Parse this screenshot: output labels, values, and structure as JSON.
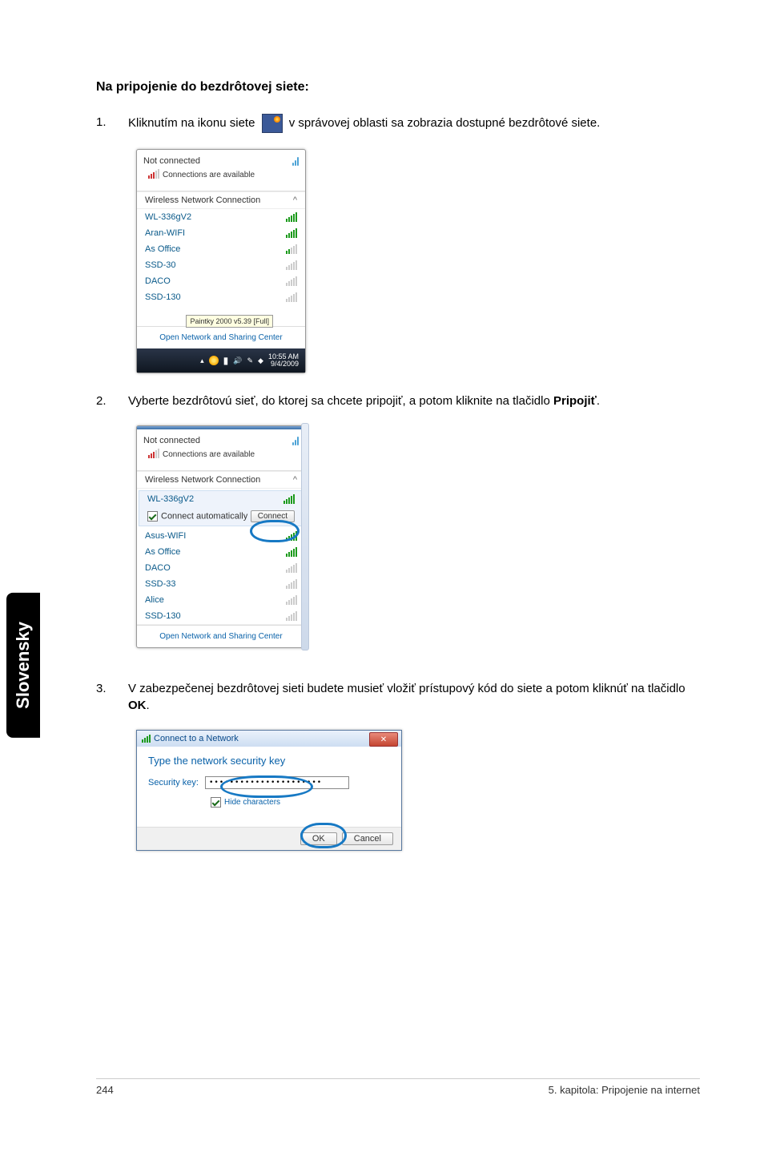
{
  "heading": "Na pripojenie do bezdrôtovej siete:",
  "step1": {
    "num": "1.",
    "text_a": "Kliknutím na ikonu siete ",
    "text_b": " v správovej oblasti sa zobrazia dostupné bezdrôtové siete."
  },
  "flyout1": {
    "not_connected": "Not connected",
    "conn_avail": "Connections are available",
    "section": "Wireless Network Connection",
    "nets": [
      "WL-336gV2",
      "Aran-WIFI",
      "As Office",
      "SSD-30",
      "DACO",
      "SSD-130"
    ],
    "open_center": "Open Network and Sharing Center",
    "tooltip": "Paintky 2000 v5.39 [Full]",
    "time1": "10:55 AM",
    "time2": "9/4/2009"
  },
  "step2": {
    "num": "2.",
    "text": "Vyberte bezdrôtovú sieť, do ktorej sa chcete pripojiť, a potom kliknite na tlačidlo",
    "bold": "Pripojiť"
  },
  "flyout2": {
    "not_connected": "Not connected",
    "conn_avail": "Connections are available",
    "section": "Wireless Network Connection",
    "selected": "WL-336gV2",
    "auto": "Connect automatically",
    "connect": "Connect",
    "nets": [
      "Asus-WIFI",
      "As Office",
      "DACO",
      "SSD-33",
      "Alice",
      "SSD-130"
    ],
    "open_center": "Open Network and Sharing Center"
  },
  "step3": {
    "num": "3.",
    "text": "V zabezpečenej bezdrôtovej sieti budete musieť vložiť prístupový kód do siete a potom kliknúť na tlačidlo ",
    "bold": "OK"
  },
  "dialog": {
    "title": "Connect to a Network",
    "heading": "Type the network security key",
    "label": "Security key:",
    "value": "••••••••••••••••••••••",
    "hide": "Hide characters",
    "ok": "OK",
    "cancel": "Cancel"
  },
  "sidebar": "Slovensky",
  "footer": {
    "page": "244",
    "chapter": "5. kapitola: Pripojenie na internet"
  },
  "chart_data": {
    "type": "table",
    "title": "Wireless networks shown",
    "categories": [
      "WL-336gV2",
      "Aran-WIFI",
      "As Office",
      "SSD-30",
      "DACO",
      "SSD-130"
    ]
  }
}
